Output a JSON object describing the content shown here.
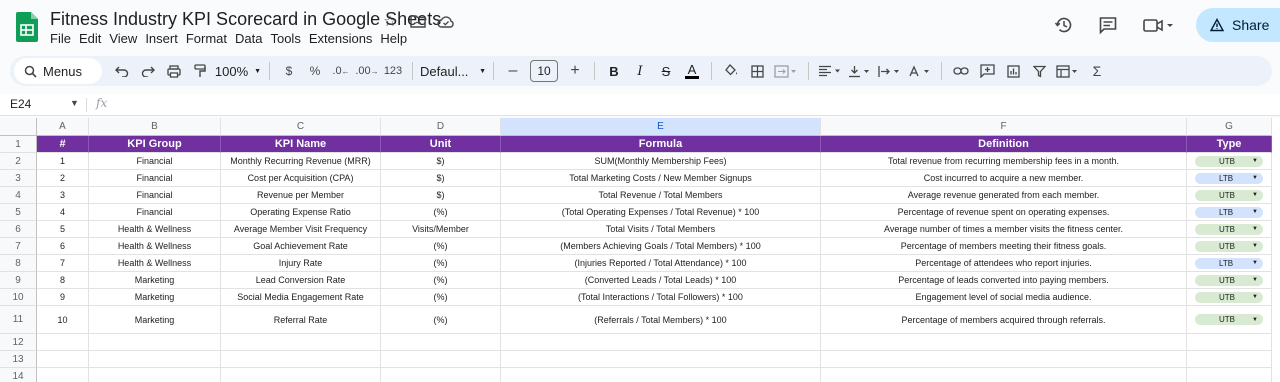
{
  "doc": {
    "title": "Fitness Industry KPI Scorecard in Google Sheets",
    "menus": [
      "File",
      "Edit",
      "View",
      "Insert",
      "Format",
      "Data",
      "Tools",
      "Extensions",
      "Help"
    ],
    "share_label": "Share"
  },
  "toolbar": {
    "search_label": "Menus",
    "zoom": "100%",
    "currency": "$",
    "percent": "%",
    "dec_decrease": ".0",
    "dec_increase": ".00",
    "number_format": "123",
    "font": "Defaul...",
    "font_size": "10",
    "minus": "–",
    "plus": "+",
    "bold": "B",
    "italic": "I",
    "strike": "S",
    "text_color": "A",
    "text_color_bar": "#000000",
    "sum": "Σ"
  },
  "formula_bar": {
    "cell_ref": "E24",
    "fx": "fx"
  },
  "columns": [
    "A",
    "B",
    "C",
    "D",
    "E",
    "F",
    "G"
  ],
  "selected_column": "E",
  "row_numbers": [
    "1",
    "2",
    "3",
    "4",
    "5",
    "6",
    "7",
    "8",
    "9",
    "10",
    "11",
    "12",
    "13",
    "14"
  ],
  "header": [
    "#",
    "KPI Group",
    "KPI Name",
    "Unit",
    "Formula",
    "Definition",
    "Type"
  ],
  "rows": [
    {
      "num": "1",
      "group": "Financial",
      "name": "Monthly Recurring Revenue (MRR)",
      "unit": "$)",
      "formula": "SUM(Monthly Membership Fees)",
      "definition": "Total revenue from recurring membership fees in a month.",
      "type": "UTB"
    },
    {
      "num": "2",
      "group": "Financial",
      "name": "Cost per Acquisition (CPA)",
      "unit": "$)",
      "formula": "Total Marketing Costs / New Member Signups",
      "definition": "Cost incurred to acquire a new member.",
      "type": "LTB"
    },
    {
      "num": "3",
      "group": "Financial",
      "name": "Revenue per Member",
      "unit": "$)",
      "formula": "Total Revenue / Total Members",
      "definition": "Average revenue generated from each member.",
      "type": "UTB"
    },
    {
      "num": "4",
      "group": "Financial",
      "name": "Operating Expense Ratio",
      "unit": "(%)",
      "formula": "(Total Operating Expenses / Total Revenue) * 100",
      "definition": "Percentage of revenue spent on operating expenses.",
      "type": "LTB"
    },
    {
      "num": "5",
      "group": "Health & Wellness",
      "name": "Average Member Visit Frequency",
      "unit": "Visits/Member",
      "formula": "Total Visits / Total Members",
      "definition": "Average number of times a member visits the fitness center.",
      "type": "UTB"
    },
    {
      "num": "6",
      "group": "Health & Wellness",
      "name": "Goal Achievement Rate",
      "unit": "(%)",
      "formula": "(Members Achieving Goals / Total Members) * 100",
      "definition": "Percentage of members meeting their fitness goals.",
      "type": "UTB"
    },
    {
      "num": "7",
      "group": "Health & Wellness",
      "name": "Injury Rate",
      "unit": "(%)",
      "formula": "(Injuries Reported / Total Attendance) * 100",
      "definition": "Percentage of attendees who report injuries.",
      "type": "LTB"
    },
    {
      "num": "8",
      "group": "Marketing",
      "name": "Lead Conversion Rate",
      "unit": "(%)",
      "formula": "(Converted Leads / Total Leads) * 100",
      "definition": "Percentage of leads converted into paying members.",
      "type": "UTB"
    },
    {
      "num": "9",
      "group": "Marketing",
      "name": "Social Media Engagement Rate",
      "unit": "(%)",
      "formula": "(Total Interactions / Total Followers) * 100",
      "definition": "Engagement level of social media audience.",
      "type": "UTB"
    },
    {
      "num": "10",
      "group": "Marketing",
      "name": "Referral Rate",
      "unit": "(%)",
      "formula": "(Referrals / Total Members) * 100",
      "definition": "Percentage of members acquired through referrals.",
      "type": "UTB"
    }
  ],
  "colors": {
    "header_purple": "#7030a0",
    "utb_chip": "#d9ead3",
    "ltb_chip": "#d3e3fd",
    "share_bg": "#c2e7ff",
    "logo_green": "#0f9d58"
  }
}
